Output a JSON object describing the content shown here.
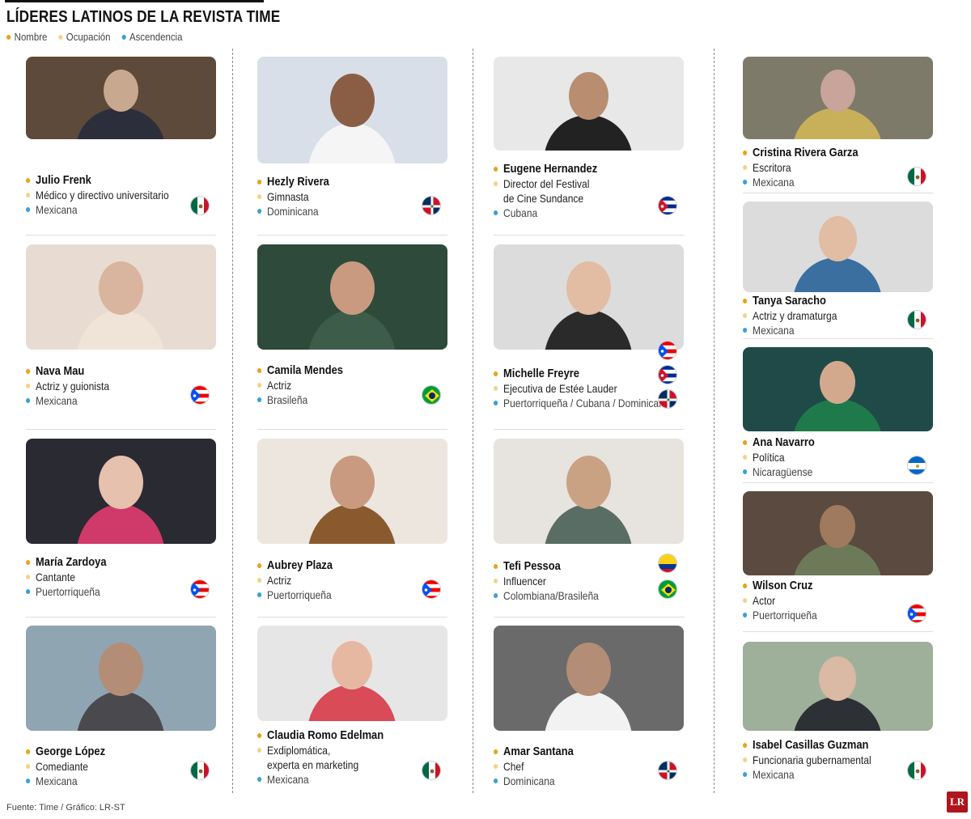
{
  "title": "LÍDERES LATINOS DE LA REVISTA TIME",
  "legend": [
    {
      "label": "Nombre",
      "color": "#e8a317"
    },
    {
      "label": "Ocupación",
      "color": "#f3d38a"
    },
    {
      "label": "Ascendencia",
      "color": "#3aa0d8"
    }
  ],
  "people": [
    {
      "name": "Julio Frenk",
      "occupation": [
        "Médico y directivo universitario"
      ],
      "ancestry": "Mexicana",
      "flags": [
        "mexico-flag-icon"
      ]
    },
    {
      "name": "Nava  Mau",
      "occupation": [
        "Actriz y guionista"
      ],
      "ancestry": "Mexicana",
      "flags": [
        "puerto-rico-flag-icon"
      ]
    },
    {
      "name": "María Zardoya",
      "occupation": [
        "Cantante"
      ],
      "ancestry": "Puertorriqueña",
      "flags": [
        "puerto-rico-flag-icon"
      ]
    },
    {
      "name": "George López",
      "occupation": [
        "Comediante"
      ],
      "ancestry": "Mexicana",
      "flags": [
        "mexico-flag-icon"
      ]
    },
    {
      "name": "Hezly Rivera",
      "occupation": [
        "Gimnasta"
      ],
      "ancestry": "Dominicana",
      "flags": [
        "dominican-republic-flag-icon"
      ]
    },
    {
      "name": "Camila Mendes",
      "occupation": [
        "Actriz"
      ],
      "ancestry": "Brasileña",
      "flags": [
        "brazil-flag-icon"
      ]
    },
    {
      "name": "Aubrey Plaza",
      "occupation": [
        "Actriz"
      ],
      "ancestry": "Puertorriqueña",
      "flags": [
        "puerto-rico-flag-icon"
      ]
    },
    {
      "name": "Claudia Romo Edelman",
      "occupation": [
        "Exdiplomática,",
        "experta en marketing"
      ],
      "ancestry": "Mexicana",
      "flags": [
        "mexico-flag-icon"
      ]
    },
    {
      "name": "Eugene Hernandez",
      "occupation": [
        "Director del Festival",
        "de Cine Sundance"
      ],
      "ancestry": "Cubana",
      "flags": [
        "cuba-flag-icon"
      ]
    },
    {
      "name": "Michelle Freyre",
      "occupation": [
        "Ejecutiva de Estée Lauder"
      ],
      "ancestry": "Puertorriqueña / Cubana / Dominicana",
      "flags": [
        "puerto-rico-flag-icon",
        "cuba-flag-icon",
        "dominican-republic-flag-icon"
      ]
    },
    {
      "name": "Tefi Pessoa",
      "occupation": [
        "Influencer"
      ],
      "ancestry": "Colombiana/Brasileña",
      "flags": [
        "colombia-flag-icon",
        "brazil-flag-icon"
      ]
    },
    {
      "name": "Amar Santana",
      "occupation": [
        "Chef"
      ],
      "ancestry": "Dominicana",
      "flags": [
        "dominican-republic-flag-icon"
      ]
    },
    {
      "name": "Cristina Rivera Garza",
      "occupation": [
        "Escritora"
      ],
      "ancestry": "Mexicana",
      "flags": [
        "mexico-flag-icon"
      ]
    },
    {
      "name": "Tanya Saracho",
      "occupation": [
        "Actriz y dramaturga"
      ],
      "ancestry": "Mexicana",
      "flags": [
        "mexico-flag-icon"
      ]
    },
    {
      "name": "Ana Navarro",
      "occupation": [
        "Política"
      ],
      "ancestry": "Nicaragüense",
      "flags": [
        "nicaragua-flag-icon"
      ]
    },
    {
      "name": "Wilson Cruz",
      "occupation": [
        "Actor"
      ],
      "ancestry": "Puertorriqueña",
      "flags": [
        "puerto-rico-flag-icon"
      ]
    },
    {
      "name": "Isabel Casillas Guzman",
      "occupation": [
        "Funcionaria gubernamental"
      ],
      "ancestry": "Mexicana",
      "flags": [
        "mexico-flag-icon"
      ]
    }
  ],
  "source": "Fuente: Time / Gráfico: LR-ST",
  "logo": "LR"
}
